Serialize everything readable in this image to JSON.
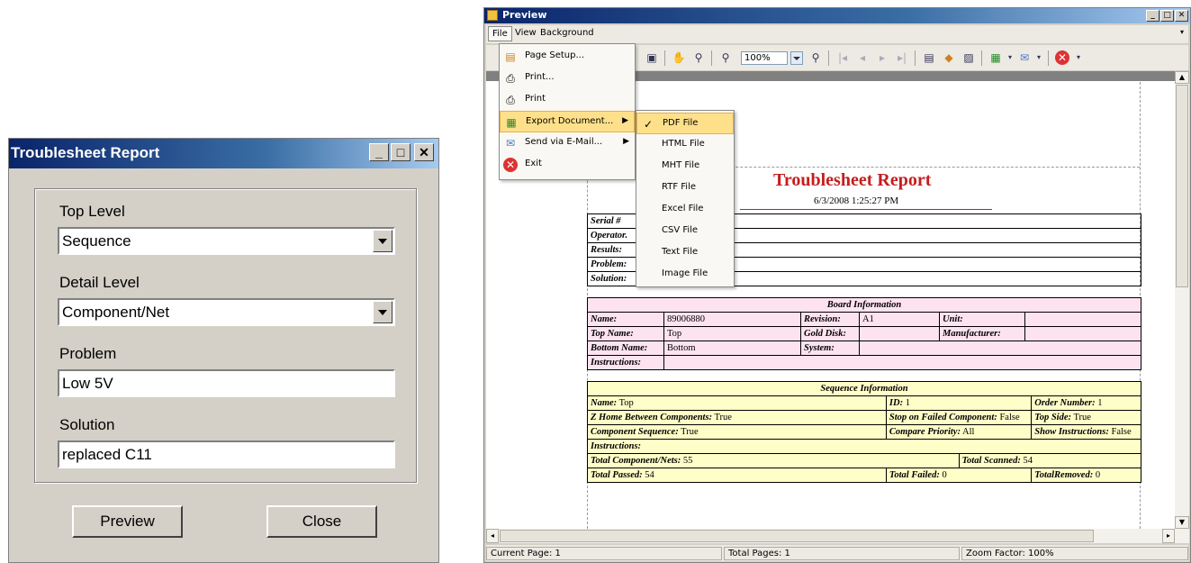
{
  "dialog": {
    "title": "Troublesheet Report",
    "top_level_label": "Top Level",
    "top_level_value": "Sequence",
    "detail_level_label": "Detail Level",
    "detail_level_value": "Component/Net",
    "problem_label": "Problem",
    "problem_value": "Low 5V",
    "solution_label": "Solution",
    "solution_value": "replaced C11",
    "preview_button": "Preview",
    "close_button": "Close"
  },
  "preview": {
    "title": "Preview",
    "menu": {
      "file": "File",
      "view": "View",
      "background": "Background"
    },
    "zoom_value": "100%",
    "file_menu": [
      {
        "label": "Page Setup...",
        "icon": "page-setup-icon"
      },
      {
        "label": "Print...",
        "icon": "print-dialog-icon"
      },
      {
        "label": "Print",
        "icon": "print-icon"
      },
      {
        "label": "Export Document...",
        "icon": "export-icon"
      },
      {
        "label": "Send via E-Mail...",
        "icon": "email-icon"
      },
      {
        "label": "Exit",
        "icon": "exit-icon"
      }
    ],
    "export_submenu": [
      "PDF File",
      "HTML File",
      "MHT File",
      "RTF File",
      "Excel File",
      "CSV File",
      "Text File",
      "Image File"
    ],
    "status": {
      "current_page": "Current Page: 1",
      "total_pages": "Total Pages: 1",
      "zoom_factor": "Zoom Factor: 100%"
    }
  },
  "report": {
    "title": "Troubleshеet Report",
    "date": "6/3/2008 1:25:27 PM",
    "header_rows": [
      "Serial #",
      "Operator.",
      "Results:",
      "Problem:",
      "Solution:"
    ],
    "board": {
      "section": "Board Information",
      "name_label": "Name:",
      "name_value": "89006880",
      "revision_label": "Revision:",
      "revision_value": "A1",
      "unit_label": "Unit:",
      "top_name_label": "Top Name:",
      "top_name_value": "Top",
      "gold_disk_label": "Gold Disk:",
      "manufacturer_label": "Manufacturer:",
      "bottom_name_label": "Bottom Name:",
      "bottom_name_value": "Bottom",
      "system_label": "System:",
      "instructions_label": "Instructions:"
    },
    "sequence": {
      "section": "Sequence Information",
      "name_label": "Name:",
      "name_value": "Top",
      "id_label": "ID:",
      "id_value": "1",
      "order_label": "Order Number:",
      "order_value": "1",
      "zhome_label": "Z Home Between Components:",
      "zhome_value": "True",
      "stop_label": "Stop on Failed Component:",
      "stop_value": "False",
      "topside_label": "Top Side:",
      "topside_value": "True",
      "compseq_label": "Component Sequence:",
      "compseq_value": "True",
      "priority_label": "Compare Priority:",
      "priority_value": "All",
      "showinst_label": "Show Instructions:",
      "showinst_value": "False",
      "instructions_label": "Instructions:",
      "totalcomp_label": "Total Component/Nets:",
      "totalcomp_value": "55",
      "totalscan_label": "Total Scanned:",
      "totalscan_value": "54",
      "passed_label": "Total Passed:",
      "passed_value": "54",
      "failed_label": "Total Failed:",
      "failed_value": "0",
      "removed_label": "TotalRemoved:",
      "removed_value": "0"
    }
  }
}
